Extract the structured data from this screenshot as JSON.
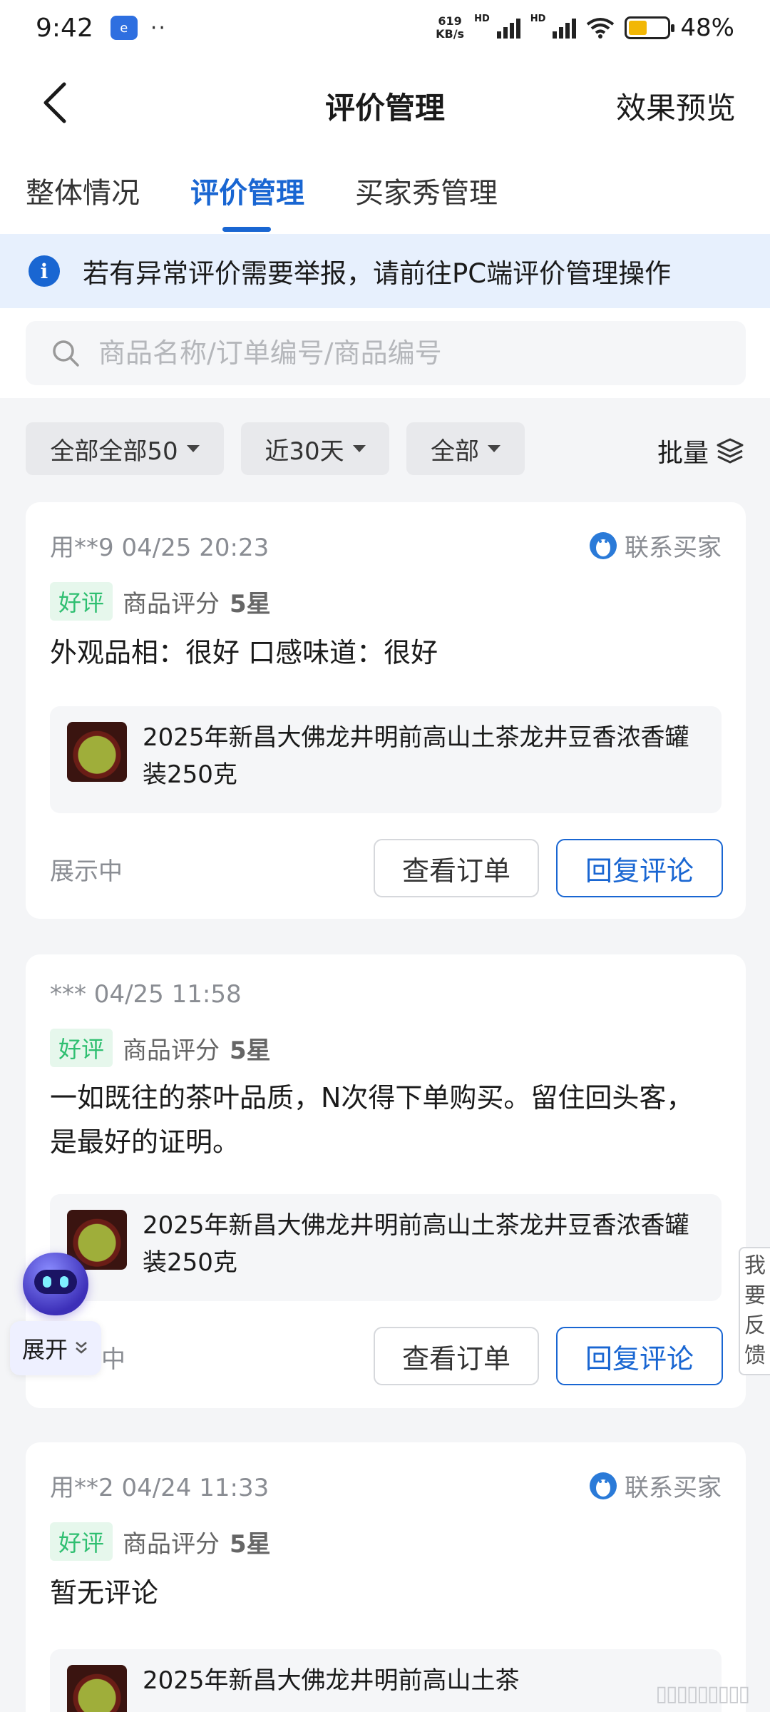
{
  "status_bar": {
    "time": "9:42",
    "net_speed_value": "619",
    "net_speed_unit": "KB/s",
    "hd1": "HD",
    "hd2": "HD",
    "battery_level": 0.48,
    "battery_text": "48%"
  },
  "header": {
    "title": "评价管理",
    "preview_label": "效果预览"
  },
  "tabs": [
    {
      "label": "整体情况",
      "active": false
    },
    {
      "label": "评价管理",
      "active": true
    },
    {
      "label": "买家秀管理",
      "active": false
    }
  ],
  "notice": {
    "icon": "i",
    "text": "若有异常评价需要举报，请前往PC端评价管理操作"
  },
  "search": {
    "placeholder": "商品名称/订单编号/商品编号"
  },
  "filters": {
    "chips": [
      {
        "label": "全部全部50"
      },
      {
        "label": "近30天"
      },
      {
        "label": "全部"
      }
    ],
    "batch_label": "批量"
  },
  "reviews": [
    {
      "reviewer": "用**9 04/25 20:23",
      "contact_label": "联系买家",
      "tag": "好评",
      "rating_label": "商品评分",
      "rating_value": "5星",
      "text": "外观品相：很好 口感味道：很好",
      "product_name": "2025年新昌大佛龙井明前高山土茶龙井豆香浓香罐装250克",
      "status": "展示中",
      "view_order_label": "查看订单",
      "reply_label": "回复评论"
    },
    {
      "reviewer": "*** 04/25 11:58",
      "tag": "好评",
      "rating_label": "商品评分",
      "rating_value": "5星",
      "text": "一如既往的茶叶品质，N次得下单购买。留住回头客，是最好的证明。",
      "product_name": "2025年新昌大佛龙井明前高山土茶龙井豆香浓香罐装250克",
      "status_partial": "中",
      "view_order_label": "查看订单",
      "reply_label": "回复评论"
    },
    {
      "reviewer": "用**2 04/24 11:33",
      "contact_label": "联系买家",
      "tag": "好评",
      "rating_label": "商品评分",
      "rating_value": "5星",
      "text": "暂无评论",
      "product_name": "2025年新昌大佛龙井明前高山土茶"
    }
  ],
  "floating": {
    "expand_label": "展开",
    "feedback_label": "我要反馈"
  },
  "colors": {
    "accent": "#1966d2",
    "good_tag": "#2fbf71",
    "notice_bg": "#e7f0fd"
  }
}
